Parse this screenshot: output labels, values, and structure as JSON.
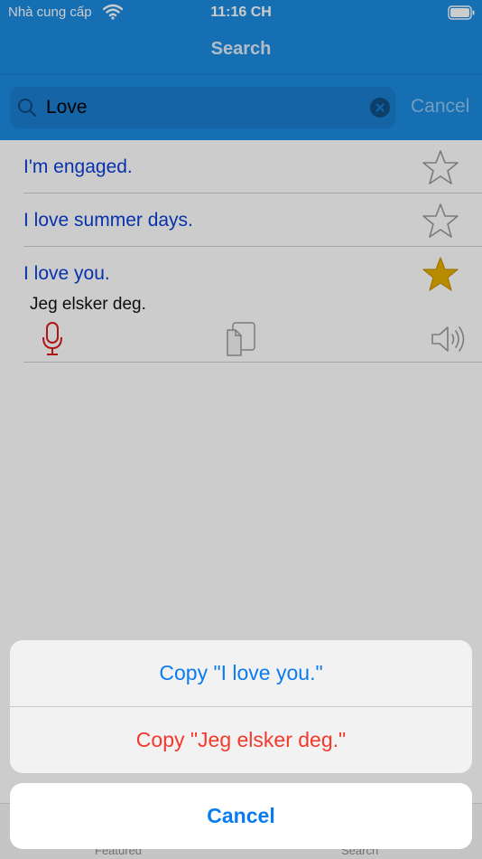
{
  "status_bar": {
    "carrier": "Nhà cung cấp",
    "time": "11:16 CH"
  },
  "nav": {
    "title": "Search"
  },
  "search": {
    "value": "Love",
    "cancel_label": "Cancel"
  },
  "results": [
    {
      "phrase": "I'm engaged.",
      "favorite": false
    },
    {
      "phrase": "I love summer days.",
      "favorite": false
    },
    {
      "phrase": "I love you.",
      "translation": "Jeg elsker deg.",
      "favorite": true
    }
  ],
  "tabs": [
    {
      "label": "Featured"
    },
    {
      "label": "Search"
    }
  ],
  "action_sheet": {
    "actions": [
      {
        "label": "Copy \"I love you.\"",
        "color": "#0a7cf0"
      },
      {
        "label": "Copy \"Jeg elsker deg.\"",
        "color": "#f2392b"
      }
    ],
    "cancel_label": "Cancel"
  },
  "colors": {
    "header": "#1d8be0",
    "phrase": "#0b3fd8",
    "favorite_star": "#e8b000",
    "mic": "#d91c1c"
  }
}
